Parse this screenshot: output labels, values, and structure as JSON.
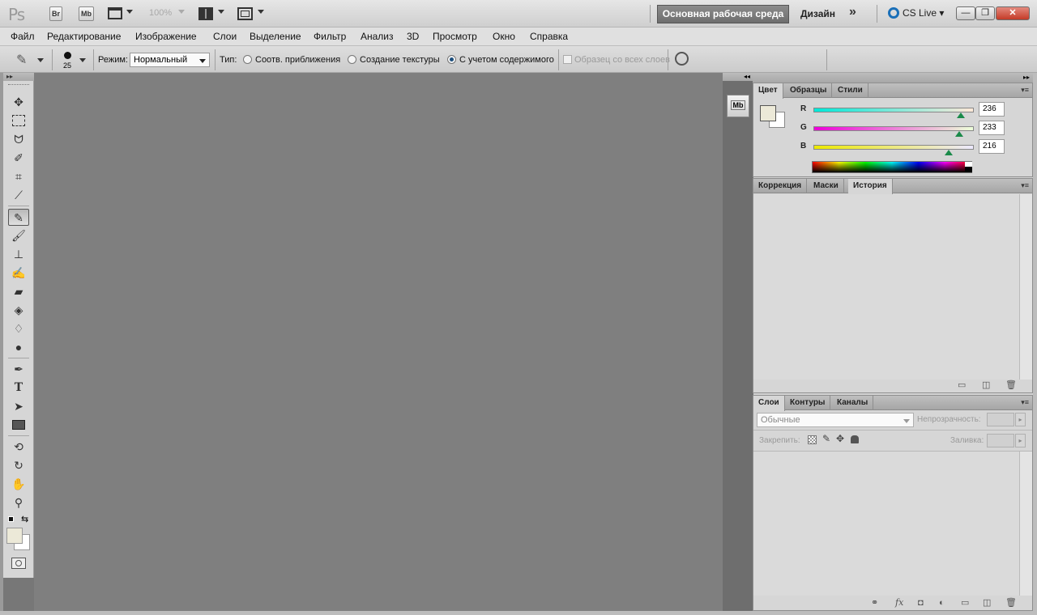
{
  "app": {
    "logo": "Ps"
  },
  "topbar": {
    "bridge": "Br",
    "minibridge": "Mb",
    "zoom": "100%",
    "workspace_active": "Основная рабочая среда",
    "workspace_design": "Дизайн",
    "more": "»",
    "cslive": "CS Live",
    "minimize": "—",
    "restore": "❐",
    "close": "✕"
  },
  "menu": [
    "Файл",
    "Редактирование",
    "Изображение",
    "Слои",
    "Выделение",
    "Фильтр",
    "Анализ",
    "3D",
    "Просмотр",
    "Окно",
    "Справка"
  ],
  "options": {
    "brush_size": "25",
    "mode_label": "Режим:",
    "mode_value": "Нормальный",
    "type_label": "Тип:",
    "radio1": "Соотв. приближения",
    "radio2": "Создание текстуры",
    "radio3": "С учетом содержимого",
    "sample_all": "Образец со всех слоев"
  },
  "color_panel": {
    "tabs": [
      "Цвет",
      "Образцы",
      "Стили"
    ],
    "r_label": "R",
    "g_label": "G",
    "b_label": "B",
    "r": "236",
    "g": "233",
    "b": "216",
    "foreground": "#ece9d8",
    "background": "#ffffff"
  },
  "history_panel": {
    "tabs": [
      "Коррекция",
      "Маски",
      "История"
    ]
  },
  "layers_panel": {
    "tabs": [
      "Слои",
      "Контуры",
      "Каналы"
    ],
    "blend": "Обычные",
    "opacity_label": "Непрозрачность:",
    "lock_label": "Закрепить:",
    "fill_label": "Заливка:"
  }
}
